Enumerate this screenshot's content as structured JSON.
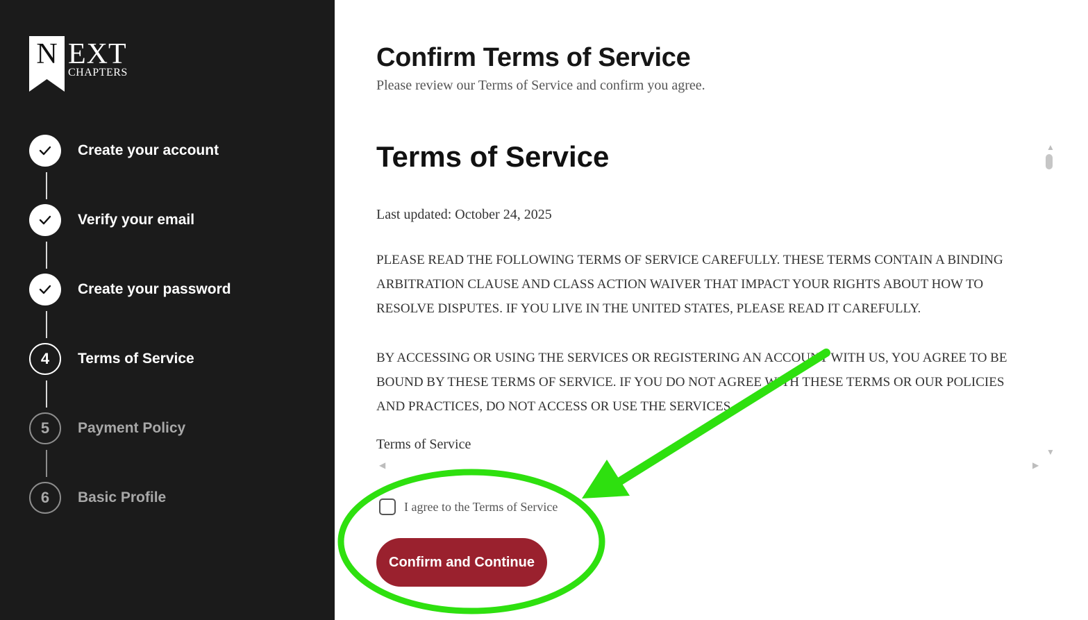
{
  "brand": {
    "logo_n": "N",
    "logo_ext": "EXT",
    "logo_sub": "CHAPTERS"
  },
  "steps": [
    {
      "status": "done",
      "marker_icon": "check-icon",
      "label": "Create your account"
    },
    {
      "status": "done",
      "marker_icon": "check-icon",
      "label": "Verify your email"
    },
    {
      "status": "done",
      "marker_icon": "check-icon",
      "label": "Create your password"
    },
    {
      "status": "current",
      "number": "4",
      "label": "Terms of Service"
    },
    {
      "status": "todo",
      "number": "5",
      "label": "Payment Policy"
    },
    {
      "status": "todo",
      "number": "6",
      "label": "Basic Profile"
    }
  ],
  "page": {
    "title": "Confirm Terms of Service",
    "subtitle": "Please review our Terms of Service and confirm you agree."
  },
  "tos": {
    "heading": "Terms of Service",
    "last_updated": "Last updated: October 24, 2025",
    "paragraphs": [
      "PLEASE READ THE FOLLOWING TERMS OF SERVICE CAREFULLY. THESE TERMS CONTAIN A BINDING ARBITRATION CLAUSE AND CLASS ACTION WAIVER THAT IMPACT YOUR RIGHTS ABOUT HOW TO RESOLVE DISPUTES. IF YOU LIVE IN THE UNITED STATES, PLEASE READ IT CAREFULLY.",
      "BY ACCESSING OR USING THE SERVICES OR REGISTERING AN ACCOUNT WITH US, YOU AGREE TO BE BOUND BY THESE TERMS OF SERVICE. IF YOU DO NOT AGREE WITH THESE TERMS OR OUR POLICIES AND PRACTICES, DO NOT ACCESS OR USE THE SERVICES."
    ],
    "subheading": "Terms of Service"
  },
  "agree": {
    "label": "I agree to the Terms of Service",
    "checked": false
  },
  "confirm_button": {
    "label": "Confirm and Continue"
  },
  "colors": {
    "sidebar_bg": "#1b1b1b",
    "button_bg": "#9a212e",
    "annotation": "#2ee00f"
  }
}
